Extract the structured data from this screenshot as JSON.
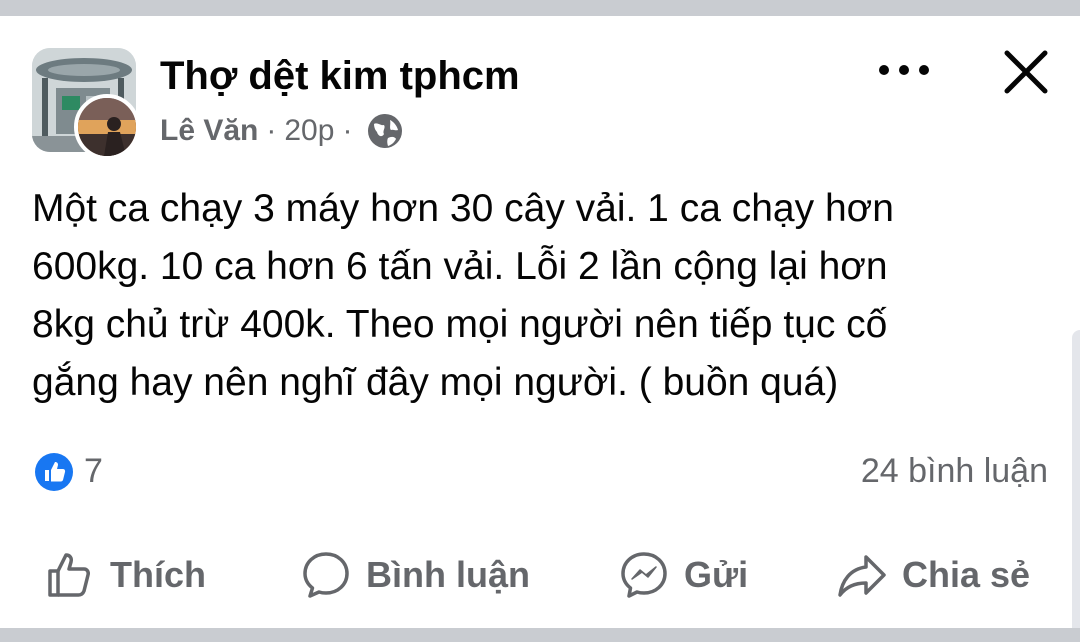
{
  "post": {
    "group_name": "Thợ dệt kim tphcm",
    "author": "Lê Văn",
    "separator": "·",
    "time": "20p",
    "visibility_icon": "globe-icon",
    "more_icon": "more-horizontal-icon",
    "close_icon": "close-icon",
    "body": "Một ca chạy 3 máy hơn 30 cây vải. 1 ca chạy hơn\n600kg. 10 ca hơn 6 tấn vải. Lỗi 2 lần cộng lại hơn\n8kg chủ trừ 400k. Theo mọi người nên tiếp tục cố\ngắng hay nên nghĩ đây mọi người. ( buồn quá)"
  },
  "reactions": {
    "icon": "like-reaction-icon",
    "count": "7",
    "comments": "24 bình luận"
  },
  "actions": {
    "like": {
      "label": "Thích",
      "icon": "thumbs-up-icon"
    },
    "comment": {
      "label": "Bình luận",
      "icon": "comment-icon"
    },
    "send": {
      "label": "Gửi",
      "icon": "messenger-icon"
    },
    "share": {
      "label": "Chia sẻ",
      "icon": "share-icon"
    }
  },
  "colors": {
    "text_primary": "#050505",
    "text_secondary": "#65676b",
    "like_blue": "#1877f2",
    "divider": "#c9ccd1"
  }
}
